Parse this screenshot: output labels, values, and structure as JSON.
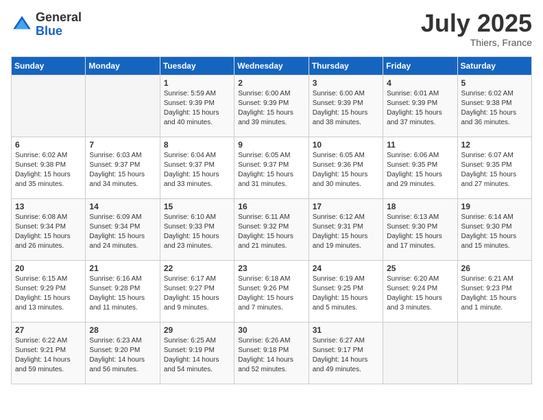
{
  "logo": {
    "general": "General",
    "blue": "Blue"
  },
  "title": {
    "month_year": "July 2025",
    "location": "Thiers, France"
  },
  "days_of_week": [
    "Sunday",
    "Monday",
    "Tuesday",
    "Wednesday",
    "Thursday",
    "Friday",
    "Saturday"
  ],
  "weeks": [
    [
      {
        "day": "",
        "sunrise": "",
        "sunset": "",
        "daylight": ""
      },
      {
        "day": "",
        "sunrise": "",
        "sunset": "",
        "daylight": ""
      },
      {
        "day": "1",
        "sunrise": "Sunrise: 5:59 AM",
        "sunset": "Sunset: 9:39 PM",
        "daylight": "Daylight: 15 hours and 40 minutes."
      },
      {
        "day": "2",
        "sunrise": "Sunrise: 6:00 AM",
        "sunset": "Sunset: 9:39 PM",
        "daylight": "Daylight: 15 hours and 39 minutes."
      },
      {
        "day": "3",
        "sunrise": "Sunrise: 6:00 AM",
        "sunset": "Sunset: 9:39 PM",
        "daylight": "Daylight: 15 hours and 38 minutes."
      },
      {
        "day": "4",
        "sunrise": "Sunrise: 6:01 AM",
        "sunset": "Sunset: 9:39 PM",
        "daylight": "Daylight: 15 hours and 37 minutes."
      },
      {
        "day": "5",
        "sunrise": "Sunrise: 6:02 AM",
        "sunset": "Sunset: 9:38 PM",
        "daylight": "Daylight: 15 hours and 36 minutes."
      }
    ],
    [
      {
        "day": "6",
        "sunrise": "Sunrise: 6:02 AM",
        "sunset": "Sunset: 9:38 PM",
        "daylight": "Daylight: 15 hours and 35 minutes."
      },
      {
        "day": "7",
        "sunrise": "Sunrise: 6:03 AM",
        "sunset": "Sunset: 9:37 PM",
        "daylight": "Daylight: 15 hours and 34 minutes."
      },
      {
        "day": "8",
        "sunrise": "Sunrise: 6:04 AM",
        "sunset": "Sunset: 9:37 PM",
        "daylight": "Daylight: 15 hours and 33 minutes."
      },
      {
        "day": "9",
        "sunrise": "Sunrise: 6:05 AM",
        "sunset": "Sunset: 9:37 PM",
        "daylight": "Daylight: 15 hours and 31 minutes."
      },
      {
        "day": "10",
        "sunrise": "Sunrise: 6:05 AM",
        "sunset": "Sunset: 9:36 PM",
        "daylight": "Daylight: 15 hours and 30 minutes."
      },
      {
        "day": "11",
        "sunrise": "Sunrise: 6:06 AM",
        "sunset": "Sunset: 9:35 PM",
        "daylight": "Daylight: 15 hours and 29 minutes."
      },
      {
        "day": "12",
        "sunrise": "Sunrise: 6:07 AM",
        "sunset": "Sunset: 9:35 PM",
        "daylight": "Daylight: 15 hours and 27 minutes."
      }
    ],
    [
      {
        "day": "13",
        "sunrise": "Sunrise: 6:08 AM",
        "sunset": "Sunset: 9:34 PM",
        "daylight": "Daylight: 15 hours and 26 minutes."
      },
      {
        "day": "14",
        "sunrise": "Sunrise: 6:09 AM",
        "sunset": "Sunset: 9:34 PM",
        "daylight": "Daylight: 15 hours and 24 minutes."
      },
      {
        "day": "15",
        "sunrise": "Sunrise: 6:10 AM",
        "sunset": "Sunset: 9:33 PM",
        "daylight": "Daylight: 15 hours and 23 minutes."
      },
      {
        "day": "16",
        "sunrise": "Sunrise: 6:11 AM",
        "sunset": "Sunset: 9:32 PM",
        "daylight": "Daylight: 15 hours and 21 minutes."
      },
      {
        "day": "17",
        "sunrise": "Sunrise: 6:12 AM",
        "sunset": "Sunset: 9:31 PM",
        "daylight": "Daylight: 15 hours and 19 minutes."
      },
      {
        "day": "18",
        "sunrise": "Sunrise: 6:13 AM",
        "sunset": "Sunset: 9:30 PM",
        "daylight": "Daylight: 15 hours and 17 minutes."
      },
      {
        "day": "19",
        "sunrise": "Sunrise: 6:14 AM",
        "sunset": "Sunset: 9:30 PM",
        "daylight": "Daylight: 15 hours and 15 minutes."
      }
    ],
    [
      {
        "day": "20",
        "sunrise": "Sunrise: 6:15 AM",
        "sunset": "Sunset: 9:29 PM",
        "daylight": "Daylight: 15 hours and 13 minutes."
      },
      {
        "day": "21",
        "sunrise": "Sunrise: 6:16 AM",
        "sunset": "Sunset: 9:28 PM",
        "daylight": "Daylight: 15 hours and 11 minutes."
      },
      {
        "day": "22",
        "sunrise": "Sunrise: 6:17 AM",
        "sunset": "Sunset: 9:27 PM",
        "daylight": "Daylight: 15 hours and 9 minutes."
      },
      {
        "day": "23",
        "sunrise": "Sunrise: 6:18 AM",
        "sunset": "Sunset: 9:26 PM",
        "daylight": "Daylight: 15 hours and 7 minutes."
      },
      {
        "day": "24",
        "sunrise": "Sunrise: 6:19 AM",
        "sunset": "Sunset: 9:25 PM",
        "daylight": "Daylight: 15 hours and 5 minutes."
      },
      {
        "day": "25",
        "sunrise": "Sunrise: 6:20 AM",
        "sunset": "Sunset: 9:24 PM",
        "daylight": "Daylight: 15 hours and 3 minutes."
      },
      {
        "day": "26",
        "sunrise": "Sunrise: 6:21 AM",
        "sunset": "Sunset: 9:23 PM",
        "daylight": "Daylight: 15 hours and 1 minute."
      }
    ],
    [
      {
        "day": "27",
        "sunrise": "Sunrise: 6:22 AM",
        "sunset": "Sunset: 9:21 PM",
        "daylight": "Daylight: 14 hours and 59 minutes."
      },
      {
        "day": "28",
        "sunrise": "Sunrise: 6:23 AM",
        "sunset": "Sunset: 9:20 PM",
        "daylight": "Daylight: 14 hours and 56 minutes."
      },
      {
        "day": "29",
        "sunrise": "Sunrise: 6:25 AM",
        "sunset": "Sunset: 9:19 PM",
        "daylight": "Daylight: 14 hours and 54 minutes."
      },
      {
        "day": "30",
        "sunrise": "Sunrise: 6:26 AM",
        "sunset": "Sunset: 9:18 PM",
        "daylight": "Daylight: 14 hours and 52 minutes."
      },
      {
        "day": "31",
        "sunrise": "Sunrise: 6:27 AM",
        "sunset": "Sunset: 9:17 PM",
        "daylight": "Daylight: 14 hours and 49 minutes."
      },
      {
        "day": "",
        "sunrise": "",
        "sunset": "",
        "daylight": ""
      },
      {
        "day": "",
        "sunrise": "",
        "sunset": "",
        "daylight": ""
      }
    ]
  ]
}
